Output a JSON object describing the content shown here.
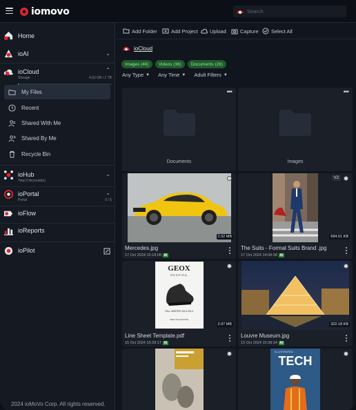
{
  "header": {
    "logo_text": "iomovo",
    "search_placeholder": "Search"
  },
  "sidebar": {
    "home": "Home",
    "ioai": "ioAI",
    "iocloud": "ioCloud",
    "storage_label": "Storage",
    "storage_value": "4.52 GB / 1 TB",
    "storage_fraction": 0.0044,
    "subitems": [
      {
        "label": "My Files",
        "icon": "folder-icon",
        "active": true
      },
      {
        "label": "Recent",
        "icon": "clock-icon"
      },
      {
        "label": "Shared With Me",
        "icon": "users-icon"
      },
      {
        "label": "Shared By Me",
        "icon": "share-icon"
      },
      {
        "label": "Recycle Bin",
        "icon": "trash-icon"
      }
    ],
    "iohub": "ioHub",
    "iohub_sub": "Total 0 Account(s)",
    "ioportal": "ioPortal",
    "ioportal_sub": "Portal",
    "ioportal_count": "0 / 5",
    "ioflow": "ioFlow",
    "ioreports": "ioReports",
    "iopilot": "ioPilot",
    "footer": "2024 ioMoVo Corp. All rights reserved."
  },
  "toolbar": {
    "add_folder": "Add Folder",
    "add_project": "Add Project",
    "upload": "Upload",
    "capture": "Capture",
    "select_all": "Select All"
  },
  "breadcrumb": "ioCloud",
  "chips": [
    "Images (46)",
    "Videos (36)",
    "Documents (26)"
  ],
  "filters": [
    "Any Type",
    "Any Time",
    "Adult Filters"
  ],
  "folders": [
    "Documents",
    "Images"
  ],
  "files": [
    {
      "name": "Mercedes.jpg",
      "date": "17 Oct 2024 15:18:08",
      "size": "2.02 MB",
      "ai": "AI"
    },
    {
      "name": "The Suits - Formal Suits Brand .jpg",
      "date": "17 Oct 2024 14:08:38",
      "size": "694.51 KB",
      "ai": "AI",
      "version": "V2"
    },
    {
      "name": "Line Sheet Template.pdf",
      "date": "15 Oct 2024 15:39:17",
      "size": "2.07 MB",
      "ai": "AI"
    },
    {
      "name": "Louvre Museum.jpg",
      "date": "15 Oct 2024 15:38:34",
      "size": "322.18 KB",
      "ai": "AI"
    },
    {
      "name": "",
      "date": "",
      "size": "",
      "ai": ""
    },
    {
      "name": "",
      "date": "",
      "size": "",
      "ai": ""
    }
  ],
  "doc_thumb": {
    "brand": "GEOX",
    "sub": "RESPIRA",
    "season": "FALL WINTER 2013-2014",
    "kids": "KIDS COLLECTION"
  },
  "tech_thumb": {
    "title": "TECH",
    "kicker": "ILLUSTRATED"
  },
  "colors": {
    "accent": "#e0262b",
    "chip_bg": "#1f5a2a",
    "chip_text": "#9fdfa6"
  }
}
